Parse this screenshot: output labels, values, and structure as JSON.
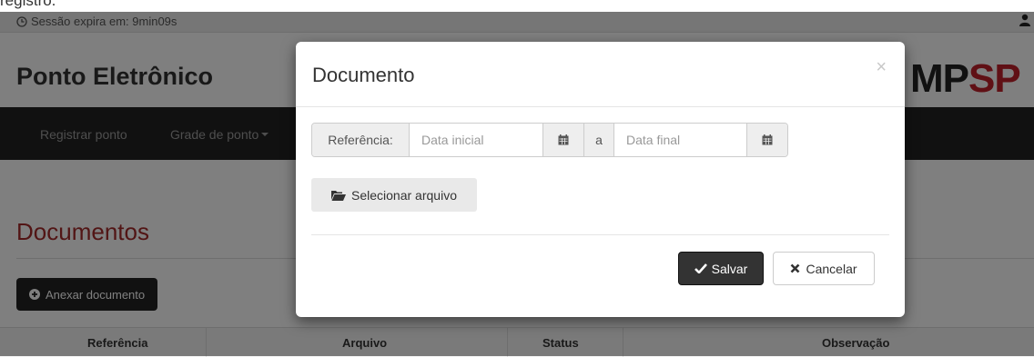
{
  "caption": "registro.",
  "session": {
    "label": "Sessão expira em: 9min09s"
  },
  "brand": {
    "title": "Ponto Eletrônico",
    "logo_left": "MP",
    "logo_right": "SP"
  },
  "nav": {
    "items": [
      "Registrar ponto",
      "Grade de ponto"
    ]
  },
  "page": {
    "heading": "Documentos",
    "attach_label": "Anexar documento",
    "table_headers": [
      "Referência",
      "Arquivo",
      "Status",
      "Observação"
    ]
  },
  "modal": {
    "title": "Documento",
    "close_glyph": "×",
    "reference_label": "Referência:",
    "start_placeholder": "Data inicial",
    "between_label": "a",
    "end_placeholder": "Data final",
    "select_file_label": "Selecionar arquivo",
    "save_label": "Salvar",
    "cancel_label": "Cancelar"
  },
  "colors": {
    "brand_red": "#c0202a",
    "heading_red": "#a52a2a",
    "navbar": "#222222"
  },
  "icons": [
    "clock-icon",
    "user-icon",
    "caret-down-icon",
    "plus-circle-icon",
    "calendar-icon",
    "folder-open-icon",
    "check-icon",
    "times-icon"
  ]
}
